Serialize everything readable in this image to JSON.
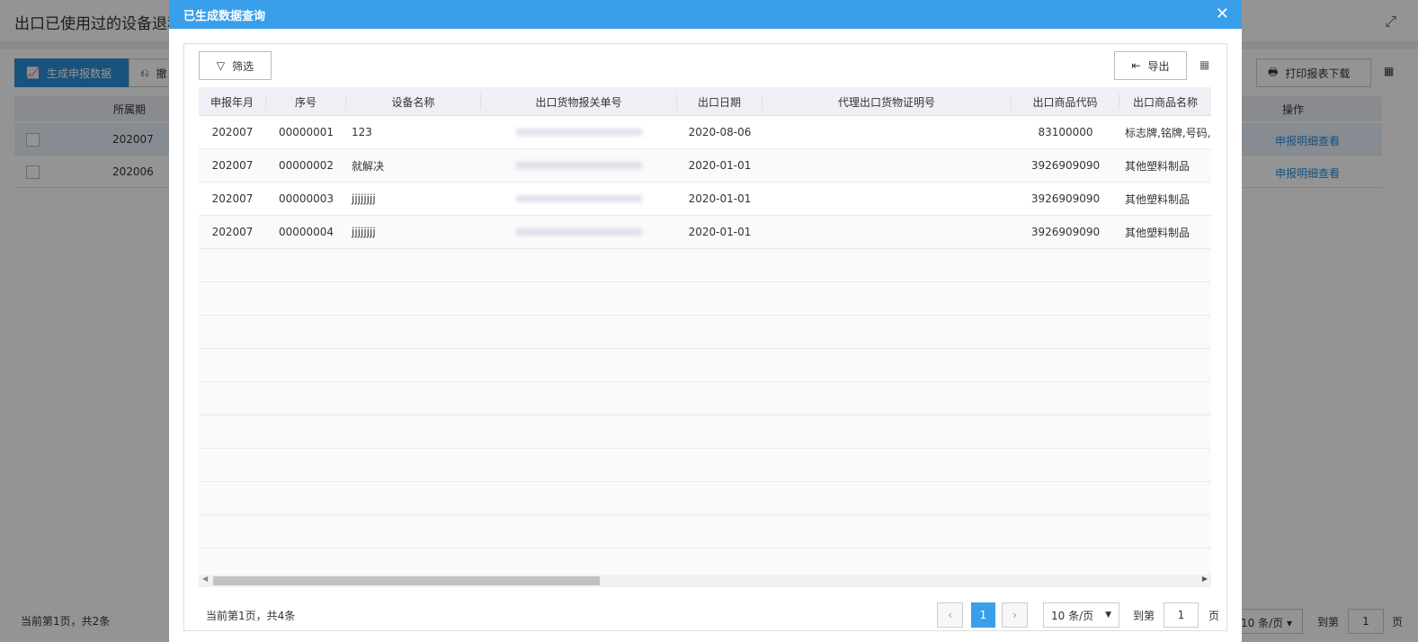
{
  "background": {
    "title": "出口已使用过的设备退税",
    "buttons": {
      "generate": "生成申报数据",
      "second": "撤",
      "print": "打印报表下载"
    },
    "columns": {
      "period": "所属期",
      "action": "操作"
    },
    "rows": [
      {
        "period": "202007",
        "action": "申报明细查看"
      },
      {
        "period": "202006",
        "action": "申报明细查看"
      }
    ],
    "footer": "当前第1页，共2条",
    "page_size": "10 条/页",
    "goto": "到第",
    "goto_value": "1",
    "page_unit": "页"
  },
  "modal": {
    "title": "已生成数据查询",
    "filter_label": "筛选",
    "export_label": "导出",
    "columns": [
      "申报年月",
      "序号",
      "设备名称",
      "出口货物报关单号",
      "出口日期",
      "代理出口货物证明号",
      "出口商品代码",
      "出口商品名称"
    ],
    "rows": [
      {
        "ym": "202007",
        "seq": "00000001",
        "name": "123",
        "date": "2020-08-06",
        "proof": "",
        "code": "83100000",
        "goods": "标志牌,铭牌,号码,字"
      },
      {
        "ym": "202007",
        "seq": "00000002",
        "name": "就解决",
        "date": "2020-01-01",
        "proof": "",
        "code": "3926909090",
        "goods": "其他塑料制品"
      },
      {
        "ym": "202007",
        "seq": "00000003",
        "name": "jjjjjjjj",
        "date": "2020-01-01",
        "proof": "",
        "code": "3926909090",
        "goods": "其他塑料制品"
      },
      {
        "ym": "202007",
        "seq": "00000004",
        "name": "jjjjjjjj",
        "date": "2020-01-01",
        "proof": "",
        "code": "3926909090",
        "goods": "其他塑料制品"
      }
    ],
    "footer": "当前第1页，共4条",
    "current_page": "1",
    "page_size": "10 条/页",
    "goto": "到第",
    "goto_value": "1",
    "page_unit": "页"
  }
}
